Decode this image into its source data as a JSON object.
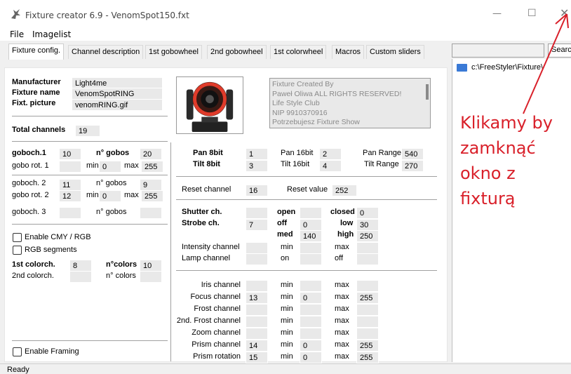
{
  "window": {
    "title": "Fixture creator 6.9 - VenomSpot150.fxt"
  },
  "menu": [
    "File",
    "Imagelist"
  ],
  "tabs": [
    "Fixture config.",
    "Channel description",
    "1st gobowheel",
    "2nd gobowheel",
    "1st colorwheel",
    "Macros",
    "Custom sliders"
  ],
  "search": {
    "button_label": "Searc"
  },
  "tree": {
    "path": "c:\\FreeStyler\\Fixture\\"
  },
  "fixture": {
    "manufacturer_label": "Manufacturer",
    "manufacturer_value": "Light4me",
    "name_label": "Fixture name",
    "name_value": "VenomSpotRING",
    "picture_label": "Fixt. picture",
    "picture_value": "venomRING.gif",
    "total_label": "Total channels",
    "total_value": "19",
    "info_lines": [
      "Fixture Created By",
      "Paweł Oliwa ALL RIGHTS RESERVED!",
      "Life Style Club",
      "NIP 9910370916",
      "Potrzebujesz Fixture   Show"
    ]
  },
  "gobo": {
    "goboch1_label": "goboch.1",
    "goboch1_value": "10",
    "ngobos_label": "n° gobos",
    "ngobos1_value": "20",
    "gobo_rot1_label": "gobo rot. 1",
    "min_label": "min",
    "max_label": "max",
    "rot1_min": "0",
    "rot1_max": "255",
    "goboch2_label": "goboch. 2",
    "goboch2_value": "11",
    "ngobos2_value": "9",
    "gobo_rot2_label": "gobo rot. 2",
    "rot2_value": "12",
    "rot2_min": "0",
    "rot2_max": "255",
    "goboch3_label": "goboch. 3"
  },
  "color": {
    "cmy_label": "Enable CMY / RGB",
    "rgbseg_label": "RGB segments",
    "colorch1_label": "1st colorch.",
    "colorch1_value": "8",
    "ncolors1_label": "n°colors",
    "ncolors1_value": "10",
    "colorch2_label": "2nd colorch.",
    "ncolors2_label": "n° colors",
    "framing_label": "Enable Framing"
  },
  "pantilt": {
    "pan8_label": "Pan 8bit",
    "pan8_value": "1",
    "tilt8_label": "Tilt 8bit",
    "tilt8_value": "3",
    "pan16_label": "Pan 16bit",
    "pan16_value": "2",
    "tilt16_label": "Tilt 16bit",
    "tilt16_value": "4",
    "panrange_label": "Pan Range",
    "panrange_value": "540",
    "tiltrange_label": "Tilt Range",
    "tiltrange_value": "270"
  },
  "reset": {
    "channel_label": "Reset channel",
    "channel_value": "16",
    "value_label": "Reset value",
    "value_value": "252"
  },
  "shutter": {
    "shutter_label": "Shutter ch.",
    "strobe_label": "Strobe ch.",
    "strobe_value": "7",
    "open_label": "open",
    "closed_label": "closed",
    "closed_value": "0",
    "off_label": "off",
    "off_value": "0",
    "low_label": "low",
    "low_value": "30",
    "med_label": "med",
    "med_value": "140",
    "high_label": "high",
    "high_value": "250",
    "intensity_label": "Intensity channel",
    "lamp_label": "Lamp channel",
    "min_label": "min",
    "max_label": "max",
    "on_label": "on",
    "off2_label": "off"
  },
  "effects": [
    {
      "label": "Iris channel",
      "value": "",
      "min": "",
      "max": ""
    },
    {
      "label": "Focus channel",
      "value": "13",
      "min": "0",
      "max": "255"
    },
    {
      "label": "Frost channel",
      "value": "",
      "min": "",
      "max": ""
    },
    {
      "label": "2nd. Frost channel",
      "value": "",
      "min": "",
      "max": ""
    },
    {
      "label": "Zoom channel",
      "value": "",
      "min": "",
      "max": ""
    },
    {
      "label": "Prism channel",
      "value": "14",
      "min": "0",
      "max": "255"
    },
    {
      "label": "Prism rotation",
      "value": "15",
      "min": "0",
      "max": "255"
    }
  ],
  "effects_labels": {
    "min": "min",
    "max": "max"
  },
  "status": {
    "text": "Ready"
  },
  "annotation": {
    "lines": [
      "Klikamy by",
      "zamknąć",
      "okno z",
      "fixturą"
    ],
    "color": "#d9202a"
  }
}
